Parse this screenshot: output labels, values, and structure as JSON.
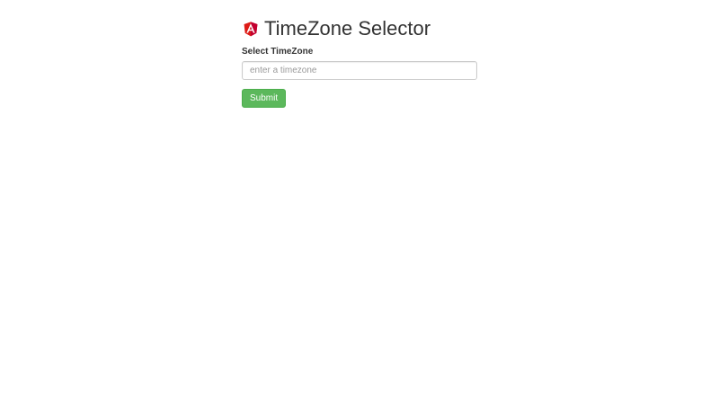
{
  "header": {
    "logo_icon": "angular-icon",
    "title": "TimeZone Selector"
  },
  "form": {
    "label": "Select TimeZone",
    "input": {
      "value": "",
      "placeholder": "enter a timezone"
    },
    "submit_label": "Submit"
  },
  "colors": {
    "logo_red": "#dd1b16",
    "logo_dark_red": "#c3002f",
    "submit_bg": "#5cb85c",
    "submit_border": "#4cae4c"
  }
}
